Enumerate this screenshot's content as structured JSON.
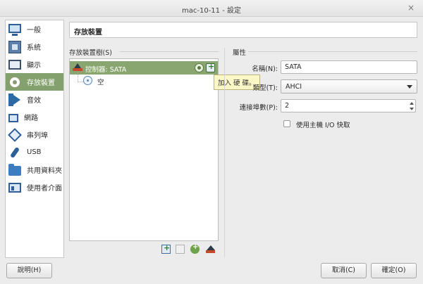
{
  "window": {
    "title": "mac-10-11 - 設定",
    "close_glyph": "×"
  },
  "sidebar": {
    "items": [
      {
        "label": "一般",
        "icon": "general-icon"
      },
      {
        "label": "系統",
        "icon": "system-icon"
      },
      {
        "label": "顯示",
        "icon": "display-icon"
      },
      {
        "label": "存放裝置",
        "icon": "storage-icon",
        "active": true
      },
      {
        "label": "音效",
        "icon": "audio-icon"
      },
      {
        "label": "網路",
        "icon": "network-icon"
      },
      {
        "label": "串列埠",
        "icon": "serial-port-icon"
      },
      {
        "label": "USB",
        "icon": "usb-icon"
      },
      {
        "label": "共用資料夾",
        "icon": "shared-folder-icon"
      },
      {
        "label": "使用者介面",
        "icon": "user-interface-icon"
      }
    ]
  },
  "page": {
    "title": "存放裝置"
  },
  "storage_tree": {
    "group_label": "存放裝置樹(S)",
    "controller_label": "控制器: SATA",
    "attachment_label": "空",
    "tooltip": "加入 硬 碟。"
  },
  "attributes": {
    "group_label": "屬性",
    "name_label": "名稱(N):",
    "name_value": "SATA",
    "type_label": "類型(T):",
    "type_value": "AHCI",
    "port_count_label": "連接埠數(P):",
    "port_count_value": "2",
    "host_io_cache_label": "使用主機 I/O 快取",
    "host_io_cache_checked": false
  },
  "buttons": {
    "help": "說明(H)",
    "cancel": "取消(C)",
    "ok": "確定(O)"
  },
  "colors": {
    "accent": "#83a16c",
    "tooltip_bg": "#fbf7c7"
  }
}
